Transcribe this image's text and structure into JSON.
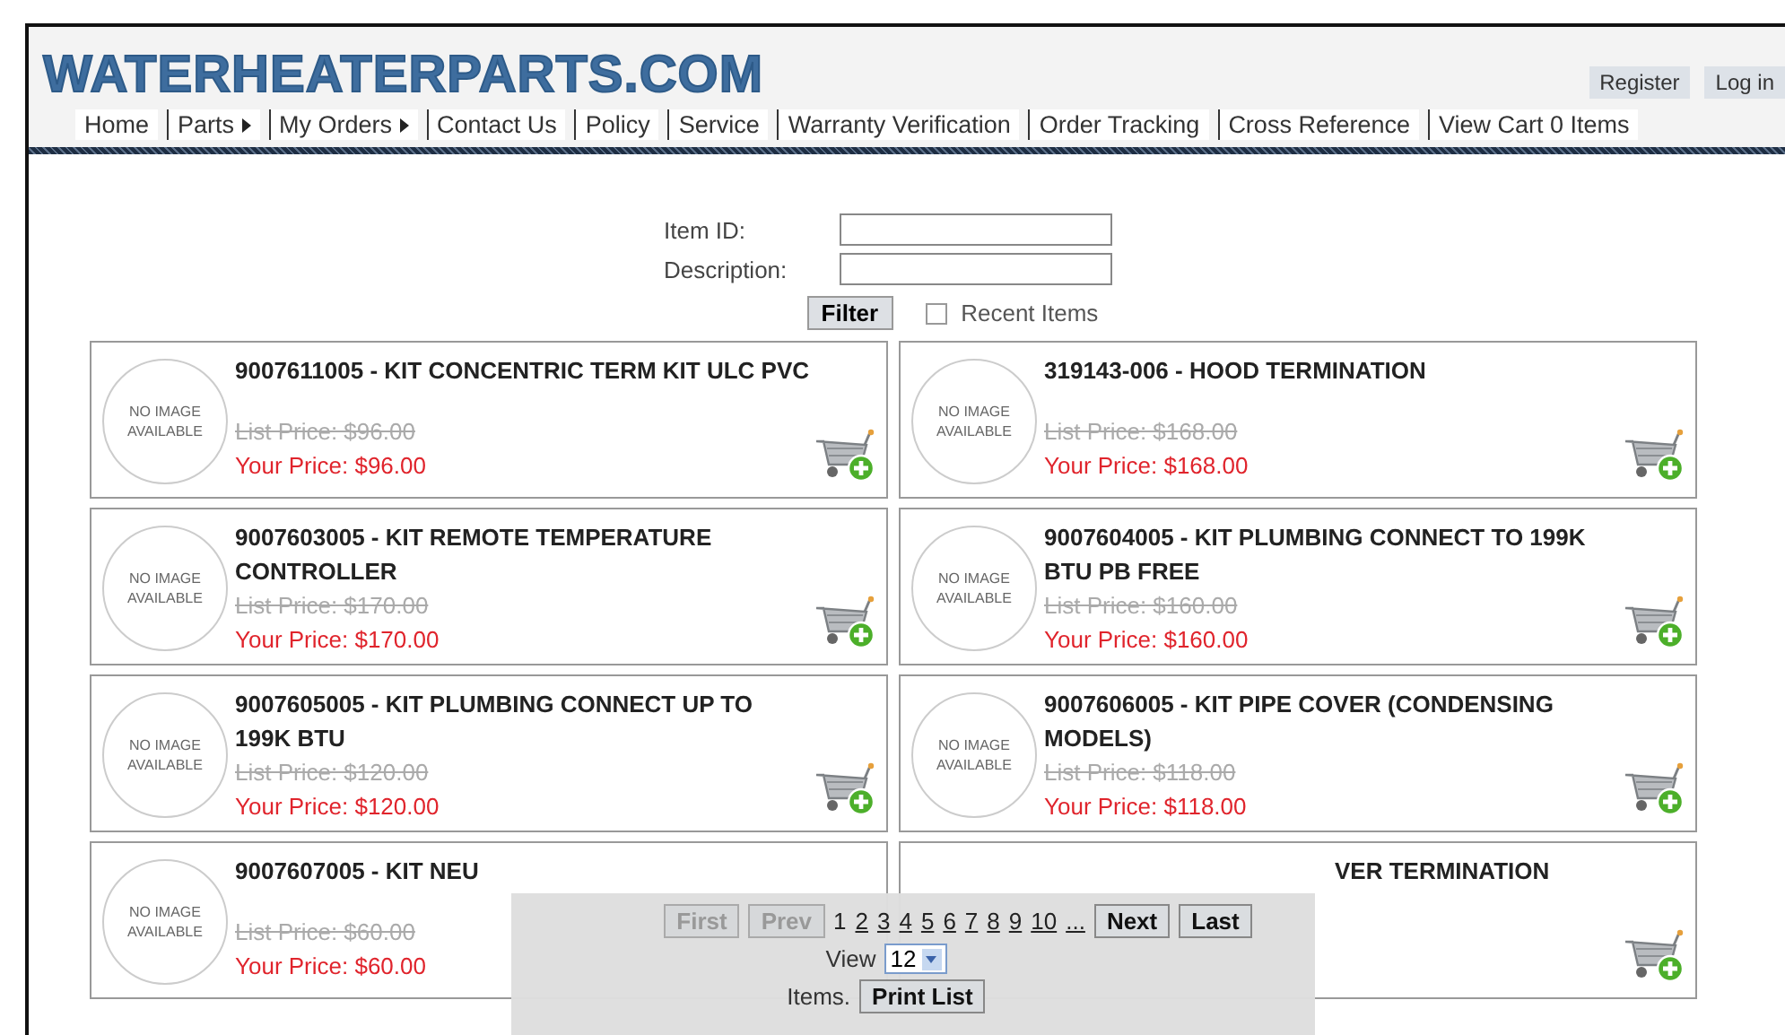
{
  "logo": "WATERHEATERPARTS.COM",
  "account_links": [
    "Register",
    "Log in"
  ],
  "nav": [
    {
      "label": "Home",
      "has_submenu": false
    },
    {
      "label": "Parts",
      "has_submenu": true
    },
    {
      "label": "My Orders",
      "has_submenu": true
    },
    {
      "label": "Contact Us",
      "has_submenu": false
    },
    {
      "label": "Policy",
      "has_submenu": false
    },
    {
      "label": "Service",
      "has_submenu": false
    },
    {
      "label": "Warranty Verification",
      "has_submenu": false
    },
    {
      "label": "Order Tracking",
      "has_submenu": false
    },
    {
      "label": "Cross Reference",
      "has_submenu": false
    },
    {
      "label": "View Cart 0 Items",
      "has_submenu": false
    }
  ],
  "filter": {
    "item_id_label": "Item ID:",
    "description_label": "Description:",
    "button": "Filter",
    "recent_items": {
      "label": "Recent Items",
      "checked": false
    }
  },
  "products": [
    {
      "image_text": "NO IMAGE AVAILABLE",
      "title": "9007611005  - KIT CONCENTRIC TERM KIT ULC PVC",
      "list_price": "List Price: $96.00",
      "your_price": "Your Price: $96.00"
    },
    {
      "image_text": "NO IMAGE AVAILABLE",
      "title": "319143-006  - HOOD TERMINATION",
      "list_price": "List Price: $168.00",
      "your_price": "Your Price: $168.00"
    },
    {
      "image_text": "NO IMAGE AVAILABLE",
      "title": "9007603005  - KIT REMOTE TEMPERATURE CONTROLLER",
      "list_price": "List Price: $170.00",
      "your_price": "Your Price: $170.00"
    },
    {
      "image_text": "NO IMAGE AVAILABLE",
      "title": "9007604005  - KIT PLUMBING CONNECT TO 199K BTU PB FREE",
      "list_price": "List Price: $160.00",
      "your_price": "Your Price: $160.00"
    },
    {
      "image_text": "NO IMAGE AVAILABLE",
      "title": "9007605005  - KIT PLUMBING CONNECT UP TO 199K BTU",
      "list_price": "List Price: $120.00",
      "your_price": "Your Price: $120.00"
    },
    {
      "image_text": "NO IMAGE AVAILABLE",
      "title": "9007606005  - KIT PIPE COVER (CONDENSING MODELS)",
      "list_price": "List Price: $118.00",
      "your_price": "Your Price: $118.00"
    },
    {
      "image_text": "NO IMAGE AVAILABLE",
      "title": "9007607005  - KIT NEU",
      "list_price": "List Price: $60.00",
      "your_price": "Your Price: $60.00"
    },
    {
      "title": "VER TERMINATION"
    }
  ],
  "pager": {
    "first": {
      "label": "First",
      "disabled": true
    },
    "prev": {
      "label": "Prev",
      "disabled": true
    },
    "pages": [
      {
        "label": "1",
        "selected": true
      },
      {
        "label": "2",
        "selected": false
      },
      {
        "label": "3",
        "selected": false
      },
      {
        "label": "4",
        "selected": false
      },
      {
        "label": "5",
        "selected": false
      },
      {
        "label": "6",
        "selected": false
      },
      {
        "label": "7",
        "selected": false
      },
      {
        "label": "8",
        "selected": false
      },
      {
        "label": "9",
        "selected": false
      },
      {
        "label": "10",
        "selected": false
      },
      {
        "label": "...",
        "selected": false
      }
    ],
    "next": {
      "label": "Next",
      "disabled": false
    },
    "last": {
      "label": "Last",
      "disabled": false
    },
    "view_label": "View",
    "view_value": "12",
    "items_label": "Items.",
    "print_button": "Print List"
  }
}
